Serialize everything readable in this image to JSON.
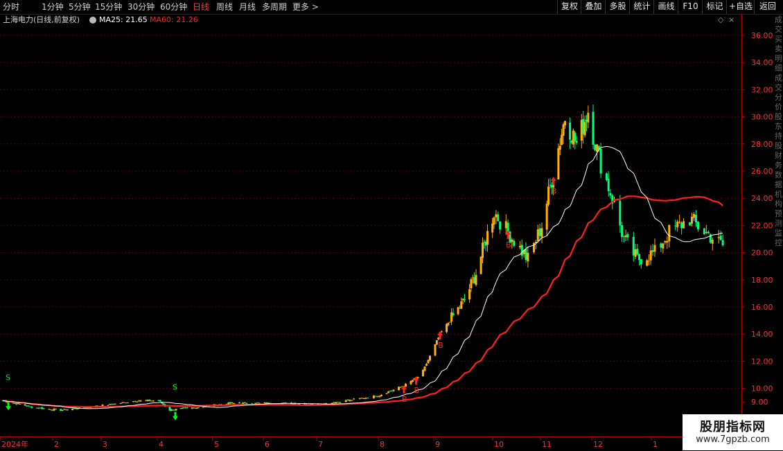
{
  "toolbar": {
    "periods": [
      "分时",
      "1分钟",
      "5分钟",
      "15分钟",
      "30分钟",
      "60分钟",
      "日线",
      "周线",
      "月线",
      "多周期",
      "更多 >"
    ],
    "active_period": "日线",
    "right_buttons": [
      "复权",
      "叠加",
      "多股",
      "统计",
      "画线",
      "F10",
      "标记",
      "+自选",
      "返回"
    ]
  },
  "title": {
    "stock": "上海电力(日线,前复权)",
    "ma25_label": "MA25: 21.65",
    "ma60_label": "MA60: 21.26",
    "ma25_color": "#ffffff",
    "ma60_color": "#ff2020"
  },
  "colors": {
    "up": "#ffb000",
    "down": "#00ff7f",
    "background": "#000000",
    "grid": "#5a0000",
    "buy": "#ff2020",
    "sell": "#00ff00"
  },
  "y_axis": {
    "ticks": [
      "36.00",
      "34.00",
      "32.00",
      "30.00",
      "28.00",
      "26.00",
      "24.00",
      "22.00",
      "20.00",
      "18.00",
      "16.00",
      "14.00",
      "12.00",
      "10.00",
      "9.00"
    ]
  },
  "x_axis": {
    "labels": [
      "2024年",
      "2",
      "3",
      "4",
      "5",
      "6",
      "7",
      "8",
      "9",
      "10",
      "11",
      "12",
      "1"
    ]
  },
  "signals": {
    "sell_label": "S",
    "buy_label": "B"
  },
  "sidebar_text": "成交买卖明细成交分价股东持股财务数据机构预测监控",
  "watermark": {
    "title": "股朋指标网",
    "url": "www.7gpzb.com"
  },
  "chart_data": {
    "type": "candlestick",
    "title": "上海电力(日线,前复权)",
    "ylim": [
      9,
      37
    ],
    "y_ticks": [
      9,
      10,
      12,
      14,
      16,
      18,
      20,
      22,
      24,
      26,
      28,
      30,
      32,
      34,
      36
    ],
    "x_month_labels": [
      "2024年",
      "2",
      "3",
      "4",
      "5",
      "6",
      "7",
      "8",
      "9",
      "10",
      "11",
      "12",
      "1"
    ],
    "ma_lines": [
      {
        "name": "MA25",
        "current": 21.65,
        "color": "#ffffff"
      },
      {
        "name": "MA60",
        "current": 21.26,
        "color": "#ff2020"
      }
    ],
    "price_path": [
      [
        "2024-01-02",
        9.1
      ],
      [
        "2024-01-20",
        8.6
      ],
      [
        "2024-02-05",
        8.4
      ],
      [
        "2024-02-20",
        8.6
      ],
      [
        "2024-03-05",
        8.8
      ],
      [
        "2024-03-20",
        9.1
      ],
      [
        "2024-04-01",
        9.1
      ],
      [
        "2024-04-08",
        8.4
      ],
      [
        "2024-04-25",
        8.6
      ],
      [
        "2024-05-15",
        8.9
      ],
      [
        "2024-06-15",
        8.9
      ],
      [
        "2024-07-01",
        8.8
      ],
      [
        "2024-07-20",
        9.2
      ],
      [
        "2024-08-01",
        9.5
      ],
      [
        "2024-08-15",
        10.2
      ],
      [
        "2024-08-25",
        11.0
      ],
      [
        "2024-09-05",
        14.0
      ],
      [
        "2024-09-20",
        16.5
      ],
      [
        "2024-09-27",
        18.5
      ],
      [
        "2024-10-08",
        23.0
      ],
      [
        "2024-10-15",
        21.5
      ],
      [
        "2024-10-25",
        19.5
      ],
      [
        "2024-11-01",
        22.0
      ],
      [
        "2024-11-08",
        26.0
      ],
      [
        "2024-11-15",
        30.0
      ],
      [
        "2024-11-22",
        28.0
      ],
      [
        "2024-11-29",
        30.5
      ],
      [
        "2024-12-05",
        27.0
      ],
      [
        "2024-12-12",
        24.0
      ],
      [
        "2024-12-18",
        21.0
      ],
      [
        "2024-12-25",
        19.5
      ],
      [
        "2025-01-03",
        20.0
      ],
      [
        "2025-01-10",
        21.5
      ],
      [
        "2025-01-20",
        22.5
      ],
      [
        "2025-01-25",
        21.8
      ],
      [
        "2025-02-05",
        20.5
      ]
    ],
    "buy_signals": [
      "2024-08-15",
      "2024-08-22",
      "2024-09-05",
      "2024-10-15",
      "2024-11-08"
    ],
    "sell_signals": [
      "2024-01-02",
      "2024-04-08"
    ]
  }
}
